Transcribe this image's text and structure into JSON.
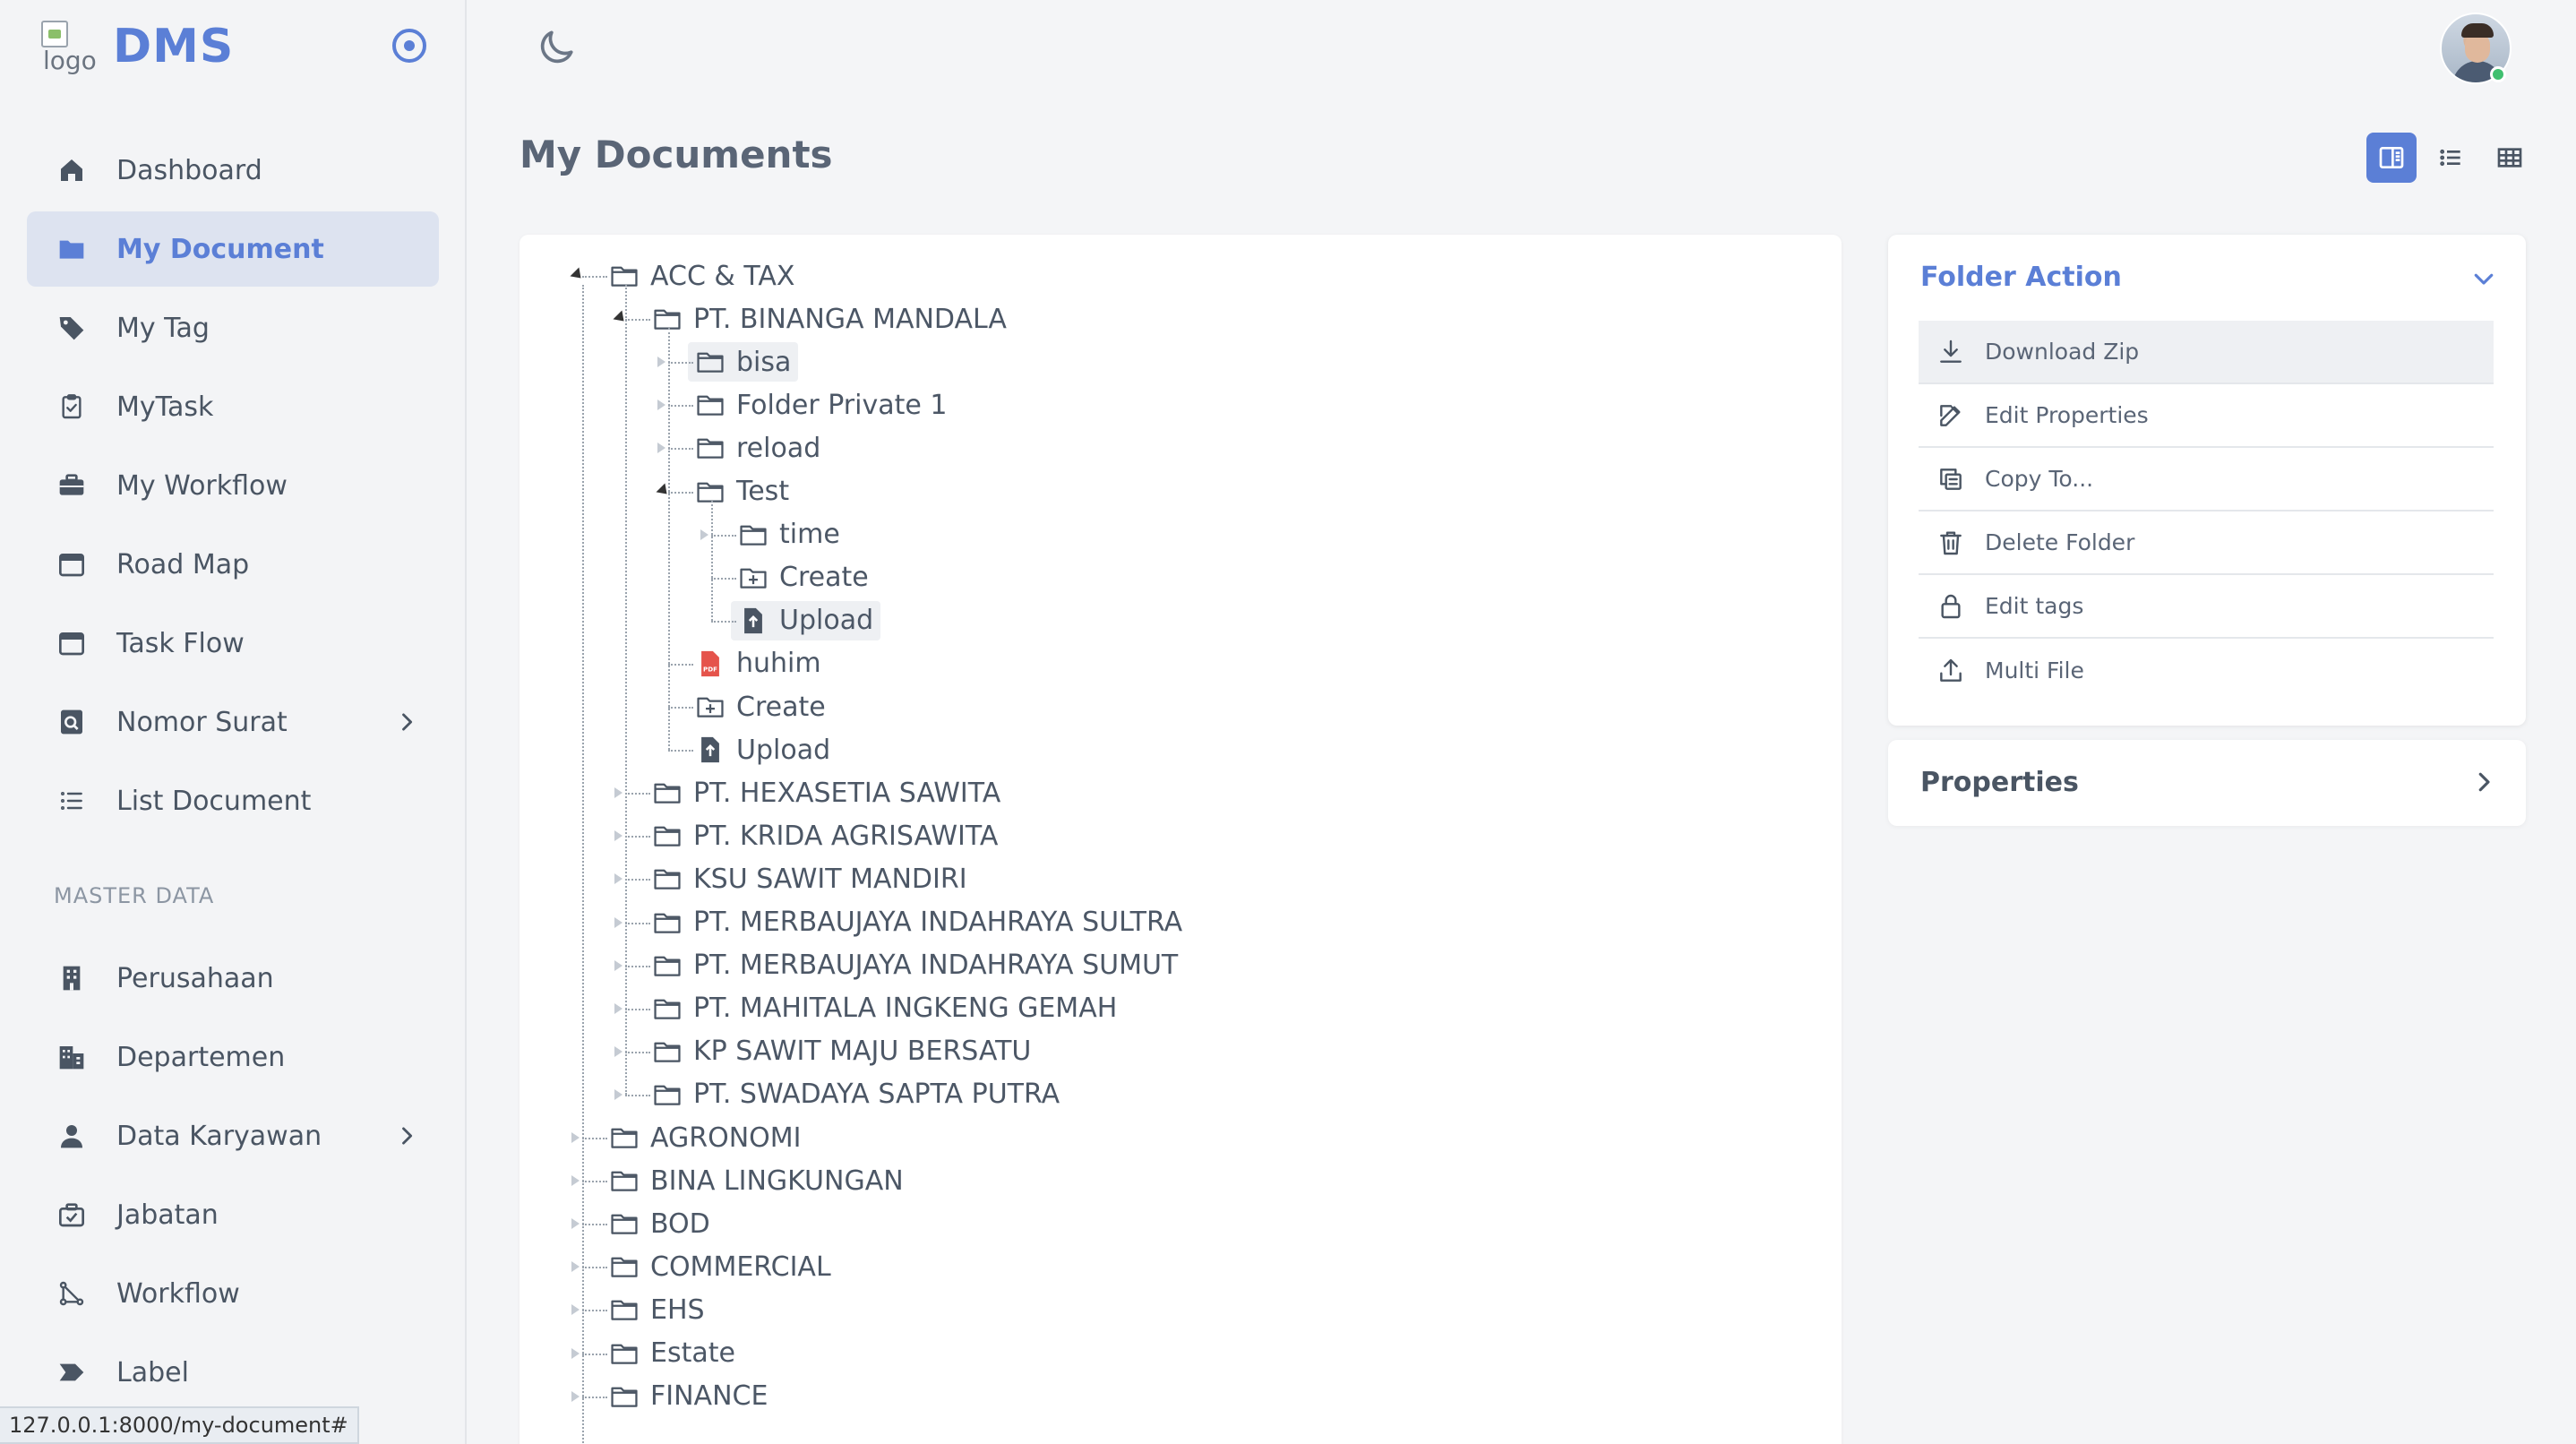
{
  "brand": {
    "name": "DMS",
    "logo_alt": "logo"
  },
  "sidebar": {
    "items": [
      {
        "label": "Dashboard",
        "icon": "home-icon"
      },
      {
        "label": "My Document",
        "icon": "folder-icon",
        "active": true
      },
      {
        "label": "My Tag",
        "icon": "tag-icon"
      },
      {
        "label": "MyTask",
        "icon": "clipboard-check-icon"
      },
      {
        "label": "My Workflow",
        "icon": "briefcase-icon"
      },
      {
        "label": "Road Map",
        "icon": "calendar-icon"
      },
      {
        "label": "Task Flow",
        "icon": "calendar-icon"
      },
      {
        "label": "Nomor Surat",
        "icon": "search-document-icon",
        "has_children": true
      },
      {
        "label": "List Document",
        "icon": "list-icon"
      }
    ],
    "section_label": "MASTER DATA",
    "master_items": [
      {
        "label": "Perusahaan",
        "icon": "building-icon"
      },
      {
        "label": "Departemen",
        "icon": "office-icon"
      },
      {
        "label": "Data Karyawan",
        "icon": "user-icon",
        "has_children": true
      },
      {
        "label": "Jabatan",
        "icon": "badge-icon"
      },
      {
        "label": "Workflow",
        "icon": "workflow-icon"
      },
      {
        "label": "Label",
        "icon": "label-icon"
      }
    ]
  },
  "status_bar": {
    "url": "127.0.0.1:8000/my-document#"
  },
  "page": {
    "title": "My Documents"
  },
  "tree": {
    "nodes": [
      {
        "label": "ACC & TAX",
        "depth": 0,
        "type": "folder",
        "toggle": "open"
      },
      {
        "label": "PT. BINANGA MANDALA",
        "depth": 1,
        "type": "folder",
        "toggle": "open"
      },
      {
        "label": "bisa",
        "depth": 2,
        "type": "folder",
        "toggle": "closed",
        "highlight": true
      },
      {
        "label": "Folder Private 1",
        "depth": 2,
        "type": "folder",
        "toggle": "closed"
      },
      {
        "label": "reload",
        "depth": 2,
        "type": "folder",
        "toggle": "closed"
      },
      {
        "label": "Test",
        "depth": 2,
        "type": "folder",
        "toggle": "open"
      },
      {
        "label": "time",
        "depth": 3,
        "type": "folder",
        "toggle": "closed"
      },
      {
        "label": "Create",
        "depth": 3,
        "type": "create"
      },
      {
        "label": "Upload",
        "depth": 3,
        "type": "upload",
        "highlight": true
      },
      {
        "label": "huhim",
        "depth": 2,
        "type": "pdf"
      },
      {
        "label": "Create",
        "depth": 2,
        "type": "create"
      },
      {
        "label": "Upload",
        "depth": 2,
        "type": "upload"
      },
      {
        "label": "PT. HEXASETIA SAWITA",
        "depth": 1,
        "type": "folder",
        "toggle": "closed"
      },
      {
        "label": "PT. KRIDA AGRISAWITA",
        "depth": 1,
        "type": "folder",
        "toggle": "closed"
      },
      {
        "label": "KSU SAWIT MANDIRI",
        "depth": 1,
        "type": "folder",
        "toggle": "closed"
      },
      {
        "label": "PT. MERBAUJAYA INDAHRAYA SULTRA",
        "depth": 1,
        "type": "folder",
        "toggle": "closed"
      },
      {
        "label": "PT. MERBAUJAYA INDAHRAYA SUMUT",
        "depth": 1,
        "type": "folder",
        "toggle": "closed"
      },
      {
        "label": "PT. MAHITALA INGKENG GEMAH",
        "depth": 1,
        "type": "folder",
        "toggle": "closed"
      },
      {
        "label": "KP SAWIT MAJU BERSATU",
        "depth": 1,
        "type": "folder",
        "toggle": "closed"
      },
      {
        "label": "PT. SWADAYA SAPTA PUTRA",
        "depth": 1,
        "type": "folder",
        "toggle": "closed"
      },
      {
        "label": "AGRONOMI",
        "depth": 0,
        "type": "folder",
        "toggle": "closed"
      },
      {
        "label": "BINA LINGKUNGAN",
        "depth": 0,
        "type": "folder",
        "toggle": "closed"
      },
      {
        "label": "BOD",
        "depth": 0,
        "type": "folder",
        "toggle": "closed"
      },
      {
        "label": "COMMERCIAL",
        "depth": 0,
        "type": "folder",
        "toggle": "closed"
      },
      {
        "label": "EHS",
        "depth": 0,
        "type": "folder",
        "toggle": "closed"
      },
      {
        "label": "Estate",
        "depth": 0,
        "type": "folder",
        "toggle": "closed"
      },
      {
        "label": "FINANCE",
        "depth": 0,
        "type": "folder",
        "toggle": "closed"
      }
    ]
  },
  "folder_action": {
    "title": "Folder Action",
    "items": [
      {
        "label": "Download Zip",
        "icon": "download-icon"
      },
      {
        "label": "Edit Properties",
        "icon": "edit-icon"
      },
      {
        "label": "Copy To...",
        "icon": "copy-icon"
      },
      {
        "label": "Delete Folder",
        "icon": "trash-icon"
      },
      {
        "label": "Edit tags",
        "icon": "lock-icon"
      },
      {
        "label": "Multi File",
        "icon": "upload-icon"
      }
    ]
  },
  "properties": {
    "title": "Properties"
  },
  "colors": {
    "accent": "#5b7fd6",
    "pdf": "#e5534b"
  }
}
